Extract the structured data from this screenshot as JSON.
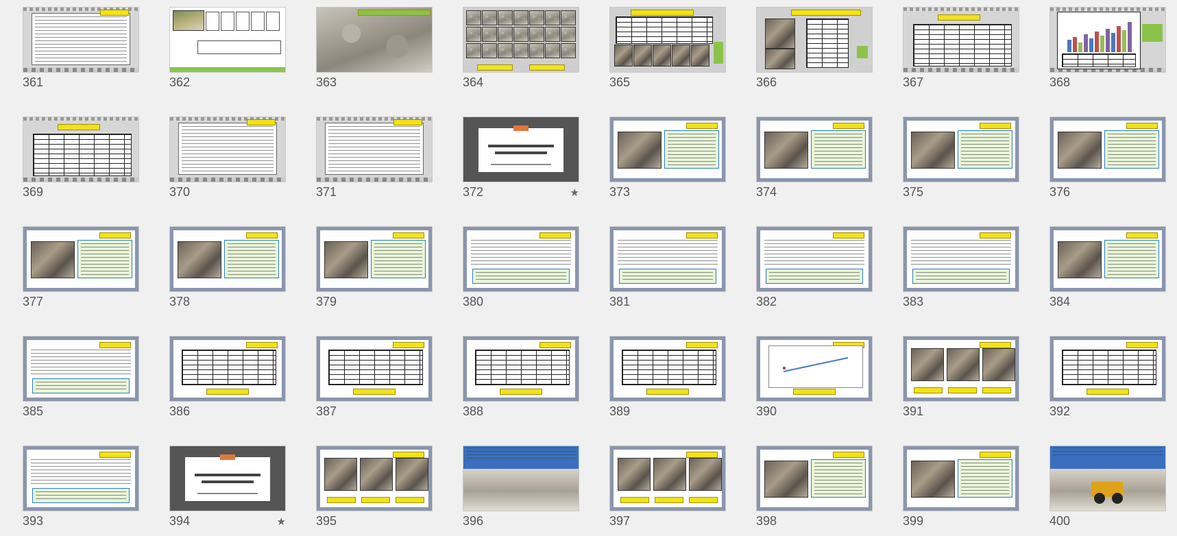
{
  "slides": [
    {
      "number": "361",
      "kind": "text"
    },
    {
      "number": "362",
      "kind": "diagram"
    },
    {
      "number": "363",
      "kind": "gravel-photo"
    },
    {
      "number": "364",
      "kind": "samples-grid"
    },
    {
      "number": "365",
      "kind": "table-photos"
    },
    {
      "number": "366",
      "kind": "photos"
    },
    {
      "number": "367",
      "kind": "table"
    },
    {
      "number": "368",
      "kind": "bar-chart"
    },
    {
      "number": "369",
      "kind": "table"
    },
    {
      "number": "370",
      "kind": "text"
    },
    {
      "number": "371",
      "kind": "text"
    },
    {
      "number": "372",
      "kind": "title",
      "starred": true
    },
    {
      "number": "373",
      "kind": "framed-photo"
    },
    {
      "number": "374",
      "kind": "framed-photo"
    },
    {
      "number": "375",
      "kind": "framed-photo"
    },
    {
      "number": "376",
      "kind": "framed-photo"
    },
    {
      "number": "377",
      "kind": "framed-photo"
    },
    {
      "number": "378",
      "kind": "framed-photo"
    },
    {
      "number": "379",
      "kind": "framed-photo"
    },
    {
      "number": "380",
      "kind": "framed-text"
    },
    {
      "number": "381",
      "kind": "framed-text"
    },
    {
      "number": "382",
      "kind": "framed-text"
    },
    {
      "number": "383",
      "kind": "framed-text"
    },
    {
      "number": "384",
      "kind": "framed-photo"
    },
    {
      "number": "385",
      "kind": "framed-text"
    },
    {
      "number": "386",
      "kind": "framed-table"
    },
    {
      "number": "387",
      "kind": "framed-table"
    },
    {
      "number": "388",
      "kind": "framed-table"
    },
    {
      "number": "389",
      "kind": "framed-table"
    },
    {
      "number": "390",
      "kind": "framed-chart"
    },
    {
      "number": "391",
      "kind": "framed-photos"
    },
    {
      "number": "392",
      "kind": "framed-table"
    },
    {
      "number": "393",
      "kind": "framed-text"
    },
    {
      "number": "394",
      "kind": "title",
      "starred": true
    },
    {
      "number": "395",
      "kind": "framed-photos"
    },
    {
      "number": "396",
      "kind": "quarry-photo"
    },
    {
      "number": "397",
      "kind": "framed-photos"
    },
    {
      "number": "398",
      "kind": "framed-photo"
    },
    {
      "number": "399",
      "kind": "framed-photo"
    },
    {
      "number": "400",
      "kind": "loader-photo"
    }
  ],
  "star_glyph": "★",
  "colors": {
    "background": "#f0f0f0",
    "frame": "#8a96ad",
    "label_yellow": "#f2e21c",
    "title_accent": "#e0773a"
  }
}
